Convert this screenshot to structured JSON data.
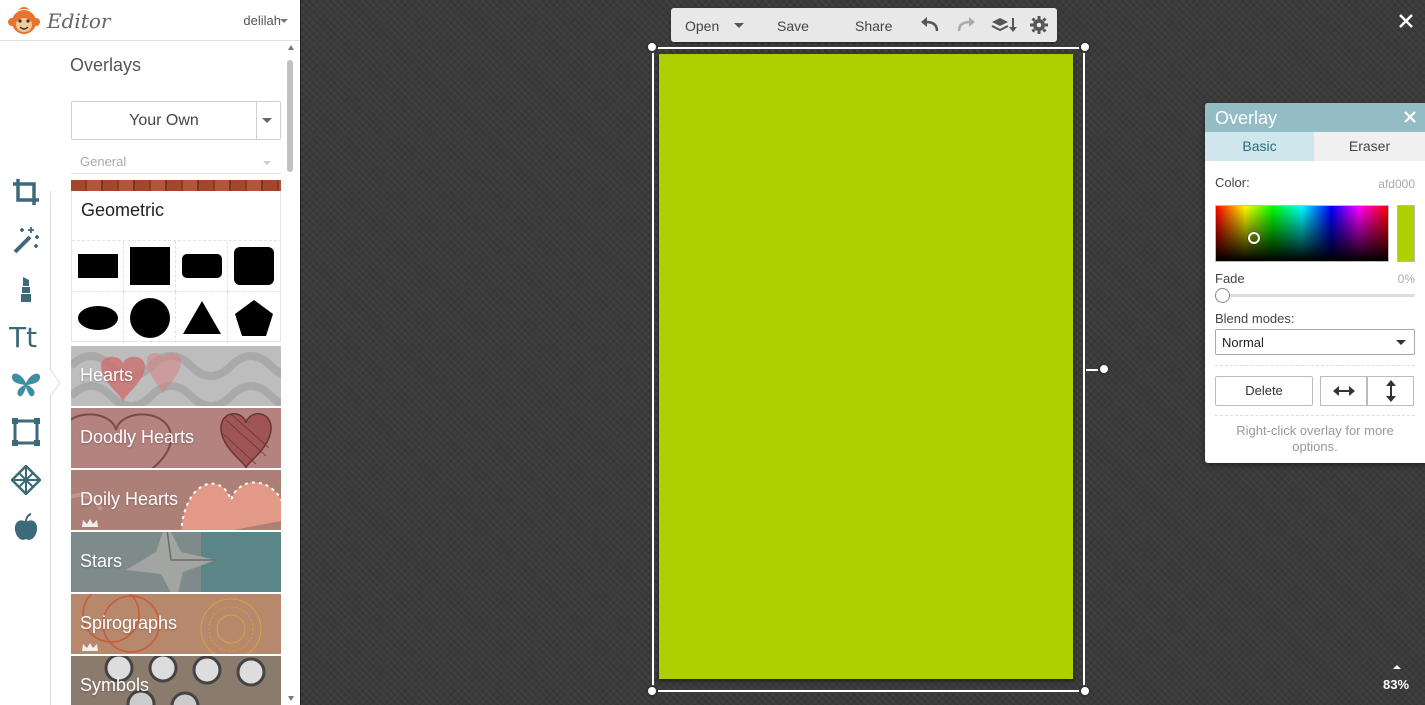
{
  "app": {
    "title": "Editor",
    "user": "delilah"
  },
  "sidebar": {
    "section_title": "Overlays",
    "mode_select": "Your Own",
    "category_select": "General",
    "geometric": {
      "title": "Geometric",
      "shapes": [
        "rectangle",
        "square",
        "rounded-rectangle",
        "rounded-square",
        "ellipse",
        "circle",
        "triangle",
        "pentagon"
      ]
    },
    "categories": [
      {
        "label": "Hearts",
        "color": "#b8b8b8",
        "premium": false
      },
      {
        "label": "Doodly Hearts",
        "color": "#b58482",
        "premium": false
      },
      {
        "label": "Doily Hearts",
        "color": "#ae8178",
        "premium": true
      },
      {
        "label": "Stars",
        "color": "#7e8a8a",
        "premium": false
      },
      {
        "label": "Spirographs",
        "color": "#b7876c",
        "premium": true
      },
      {
        "label": "Symbols",
        "color": "#8c7b6a",
        "premium": false
      }
    ],
    "tools": [
      "crop-icon",
      "magic-wand-icon",
      "lipstick-icon",
      "text-icon",
      "butterfly-icon",
      "frame-icon",
      "texture-icon",
      "apple-icon"
    ]
  },
  "toolbar": {
    "open": "Open",
    "save": "Save",
    "share": "Share"
  },
  "canvas": {
    "overlay_color": "#afd000",
    "zoom": "83%"
  },
  "overlay_panel": {
    "title": "Overlay",
    "tabs": [
      "Basic",
      "Eraser"
    ],
    "color_label": "Color:",
    "color_value": "afd000",
    "fade_label": "Fade",
    "fade_value": "0%",
    "blend_label": "Blend modes:",
    "blend_value": "Normal",
    "delete_label": "Delete",
    "hint": "Right-click overlay for more options."
  },
  "colors": {
    "accent": "#94bcc4",
    "tab_active": "#cfe6ec",
    "overlay": "#afd000",
    "brand": "#e8732e"
  }
}
